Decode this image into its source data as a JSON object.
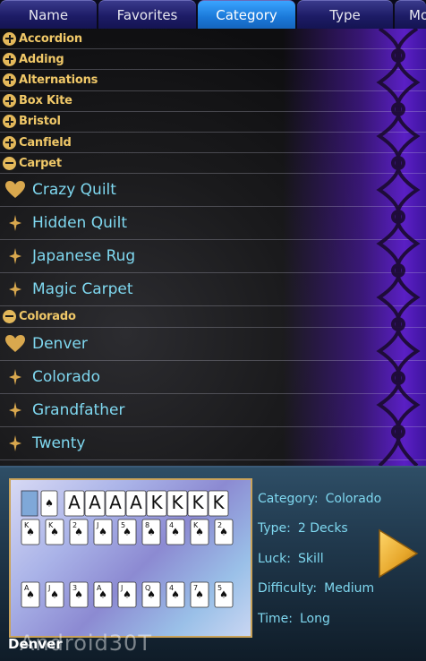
{
  "tabs": [
    {
      "label": "Name",
      "active": false
    },
    {
      "label": "Favorites",
      "active": false
    },
    {
      "label": "Category",
      "active": true
    },
    {
      "label": "Type",
      "active": false
    },
    {
      "label": "Mo",
      "active": false
    }
  ],
  "list": [
    {
      "kind": "category",
      "label": "Accordion",
      "expanded": false
    },
    {
      "kind": "category",
      "label": "Adding",
      "expanded": false
    },
    {
      "kind": "category",
      "label": "Alternations",
      "expanded": false
    },
    {
      "kind": "category",
      "label": "Box Kite",
      "expanded": false
    },
    {
      "kind": "category",
      "label": "Bristol",
      "expanded": false
    },
    {
      "kind": "category",
      "label": "Canfield",
      "expanded": false
    },
    {
      "kind": "category",
      "label": "Carpet",
      "expanded": true
    },
    {
      "kind": "game",
      "label": "Crazy Quilt",
      "icon": "heart-icon"
    },
    {
      "kind": "game",
      "label": "Hidden Quilt",
      "icon": "sparkle-icon"
    },
    {
      "kind": "game",
      "label": "Japanese Rug",
      "icon": "sparkle-icon"
    },
    {
      "kind": "game",
      "label": "Magic Carpet",
      "icon": "sparkle-icon"
    },
    {
      "kind": "category",
      "label": "Colorado",
      "expanded": true
    },
    {
      "kind": "game",
      "label": "Denver",
      "icon": "heart-icon"
    },
    {
      "kind": "game",
      "label": "Colorado",
      "icon": "sparkle-icon"
    },
    {
      "kind": "game",
      "label": "Grandfather",
      "icon": "sparkle-icon"
    },
    {
      "kind": "game",
      "label": "Twenty",
      "icon": "sparkle-icon"
    }
  ],
  "details": {
    "category_label": "Category:",
    "category_value": "Colorado",
    "type_label": "Type:",
    "type_value": "2 Decks",
    "luck_label": "Luck:",
    "luck_value": "Skill",
    "difficulty_label": "Difficulty:",
    "difficulty_value": "Medium",
    "time_label": "Time:",
    "time_value": "Long"
  },
  "preview": {
    "foundation_top": [
      "A",
      "A",
      "A",
      "A",
      "K",
      "K",
      "K",
      "K"
    ],
    "row1": [
      "K",
      "K",
      "2",
      "J",
      "5",
      "8",
      "4",
      "K",
      "2"
    ],
    "row2": [
      "A",
      "J",
      "3",
      "A",
      "J",
      "Q",
      "4",
      "7",
      "5"
    ]
  },
  "selected_game": "Denver",
  "watermark": "Android30T",
  "colors": {
    "tab_active": "#1a78d8",
    "tab_inactive": "#1d1c66",
    "category_text": "#f0c868",
    "game_text": "#7fd8f0",
    "accent_purple": "#5a1fc4",
    "play_arrow": "#e6a62a"
  }
}
